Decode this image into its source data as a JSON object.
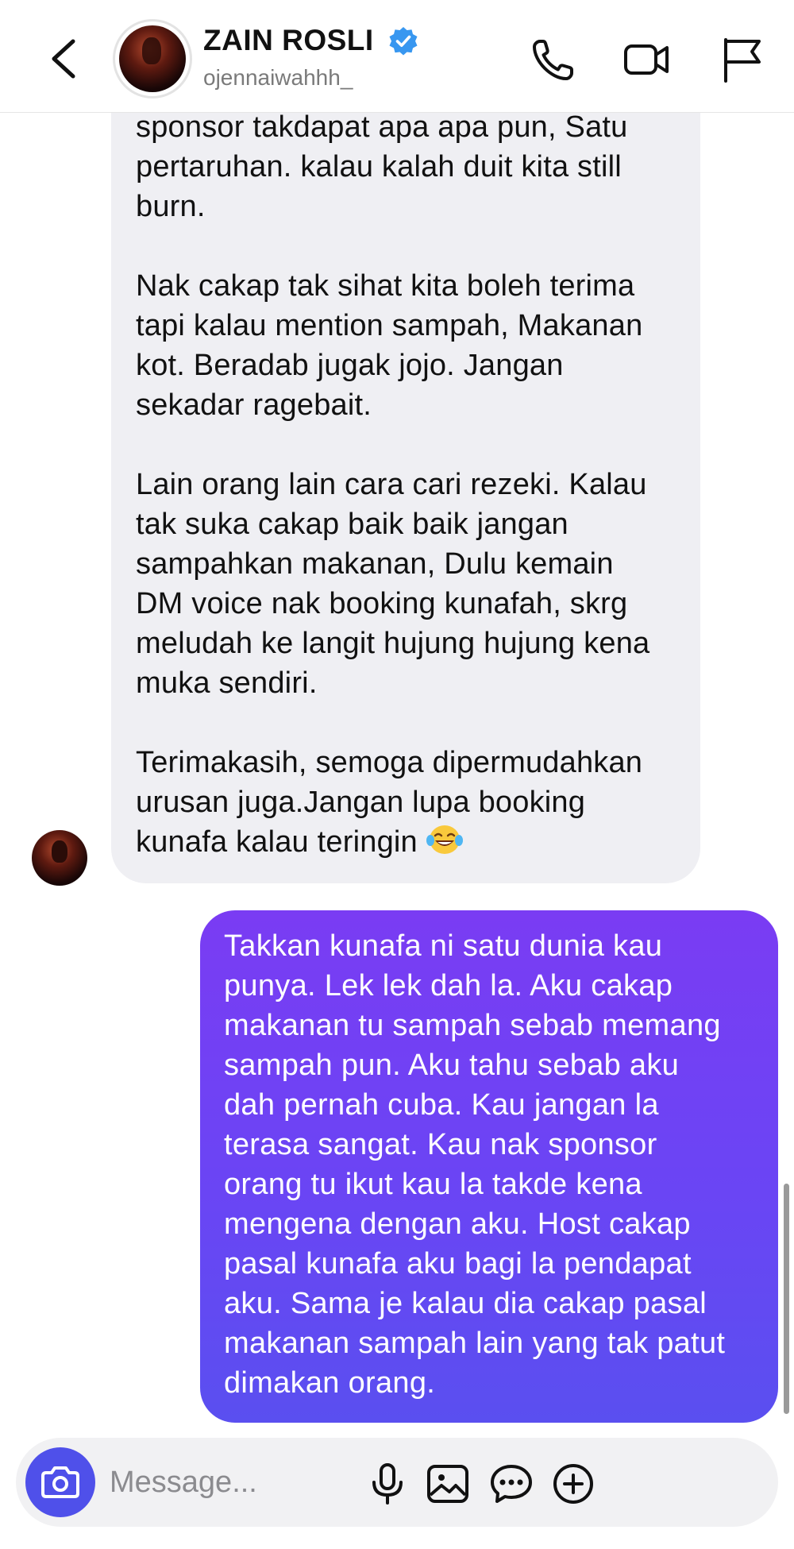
{
  "header": {
    "contact_name": "ZAIN ROSLI",
    "contact_handle": "ojennaiwahhh_",
    "icons": [
      "back-icon",
      "verified-badge-icon",
      "phone-icon",
      "video-camera-icon",
      "flag-icon"
    ]
  },
  "messages": {
    "incoming_partial_top": "sponsor takdapat apa apa pun, Satu",
    "incoming_body": "pertaruhan. kalau kalah duit kita still\nburn.\n\nNak cakap tak sihat kita boleh terima\ntapi kalau mention sampah, Makanan\nkot. Beradab jugak jojo. Jangan\nsekadar ragebait.\n\nLain orang lain cara cari rezeki. Kalau\ntak suka cakap baik baik jangan\nsampahkan makanan, Dulu kemain\nDM voice nak booking kunafah, skrg\nmeludah ke langit hujung hujung kena\nmuka sendiri.\n\nTerimakasih, semoga dipermudahkan\nurusan juga.Jangan lupa booking\nkunafa kalau teringin ",
    "incoming_emoji": "face-with-tears-of-joy-emoji",
    "outgoing_text": "Takkan kunafa ni satu dunia kau\npunya. Lek lek dah la. Aku cakap\nmakanan tu sampah sebab memang\nsampah pun. Aku tahu sebab aku\ndah pernah cuba. Kau jangan la\nterasa sangat. Kau nak sponsor\norang tu ikut kau la takde kena\nmengena dengan aku. Host cakap\npasal kunafa aku bagi la pendapat\naku. Sama je kalau dia cakap pasal\nmakanan sampah lain yang tak patut\ndimakan orang."
  },
  "composer": {
    "placeholder": "Message...",
    "icons": [
      "camera-icon",
      "microphone-icon",
      "gallery-icon",
      "sticker-icon",
      "add-icon"
    ]
  },
  "colors": {
    "outgoing_bubble_top": "#7a3cf3",
    "outgoing_bubble_bottom": "#5a4ff0",
    "incoming_bubble": "#efeff3",
    "camera_button": "#4f50ea",
    "verified_badge": "#3897f0"
  }
}
